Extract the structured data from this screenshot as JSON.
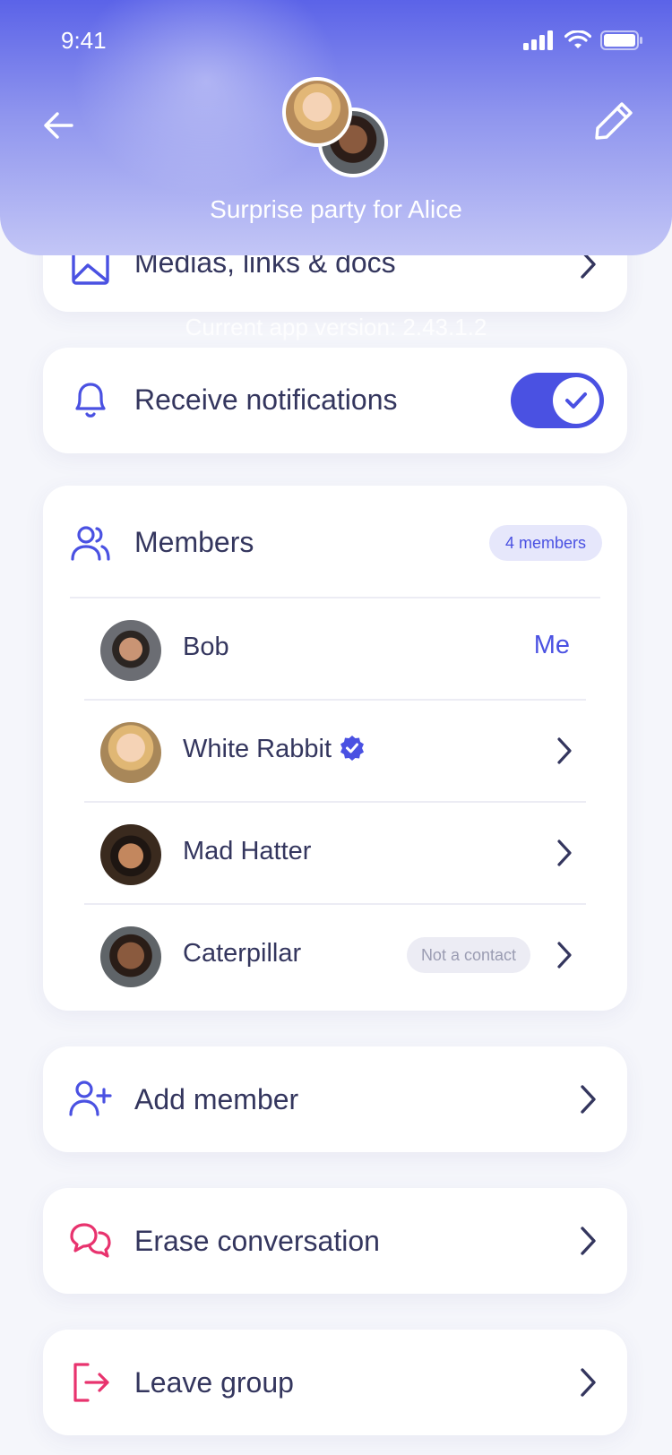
{
  "status_bar": {
    "time": "9:41"
  },
  "header": {
    "group_title": "Surprise party for Alice",
    "back_icon": "arrow-left-icon",
    "edit_icon": "pencil-icon"
  },
  "media": {
    "label": "Medias, links & docs",
    "icon": "image-icon"
  },
  "app_version": "Current app version: 2.43.1.2",
  "notifications": {
    "label": "Receive notifications",
    "enabled": true,
    "icon": "bell-icon"
  },
  "members": {
    "title": "Members",
    "count_badge": "4 members",
    "icon": "users-icon",
    "list": [
      {
        "name": "Bob",
        "tag": "Me"
      },
      {
        "name": "White Rabbit",
        "verified": true
      },
      {
        "name": "Mad Hatter"
      },
      {
        "name": "Caterpillar",
        "badge": "Not a contact"
      }
    ]
  },
  "actions": {
    "add_member": "Add member",
    "erase_conversation": "Erase conversation",
    "leave_group": "Leave group"
  },
  "colors": {
    "accent": "#4a51e2",
    "danger": "#e8336e",
    "text": "#34365e"
  }
}
